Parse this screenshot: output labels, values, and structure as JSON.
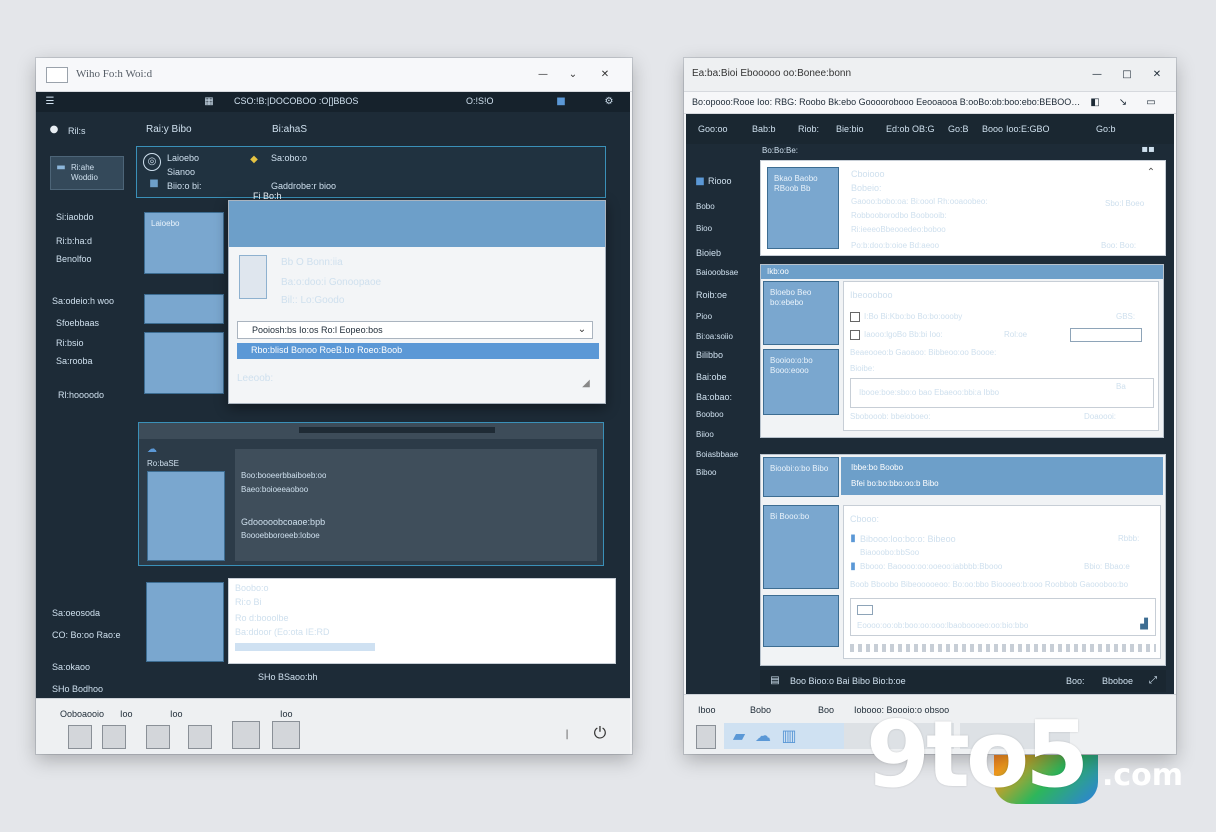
{
  "colors": {
    "background": "#e4e6ea",
    "dark_panel": "#1d2b37",
    "accent_blue": "#5b98d6",
    "card_blue": "#6d9fc9",
    "border_teal": "#3a90b8"
  },
  "left_window": {
    "title": "Wiho Fo:h Woi:d",
    "menu": [
      "CSO:!B:|DOCOBOO :O[]BBOS",
      "O:!S!O"
    ],
    "top_tabs": [
      "Rai:y Bibo",
      "Bi:ahaS"
    ],
    "sidebar": [
      "Ril:s",
      "Ri:ahe Woddio",
      "Si:iaobdo",
      "Ri:b:ha:d",
      "Benolfoo",
      "Sa:odeio:h woo",
      "Sfoebbaas",
      "Ri:bsio",
      "Sa:rooba",
      "Rl:hoooodo",
      "Sa:oeosoda",
      "CO: Bo:oo Rao:e",
      "Sa:okaoo",
      "SHo Bodhoo"
    ],
    "header_cards": [
      "Laioebo",
      "Sianoo",
      "Biio:o bi:",
      "Sa:obo:o",
      "Gaddrobe:r bioo"
    ],
    "dialog": {
      "title": "Fi Bo:h",
      "lines": [
        "Bb O Bonn:iia",
        "Ba:o:doo:i Gonoopaoe",
        "Bil:: Lo:Goodo"
      ],
      "input_value": "Pooiosh:bs Io:os Ro:l Eopeo:bos",
      "selected_row": "Rbo:blisd Bonoo RoeB.bo Roeo:Boob",
      "footer": "Leeoob:"
    },
    "lower_panel": {
      "label": "Ro:baSE",
      "lines": [
        "Boo:booeerbbaiboeb:oo",
        "Baeo:boioeeaoboo",
        "Gdooooobcoaoe:bpb",
        "Boooebboroeeb:loboe"
      ]
    },
    "bottom_card": {
      "title": "Boobo:o",
      "lines": [
        "Ri:o Bi",
        "Ro d:booolbe",
        "Ba:ddoor (Eo:ota IE:RD"
      ],
      "footer": "SHo BSaoo:bh"
    },
    "taskbar": [
      "Ooboaooio",
      "Ioo",
      "Ioo",
      "Ioo"
    ]
  },
  "right_window": {
    "title": "Ea:ba:Bioi Ebooooo oo:Bonee:bonn",
    "address": "Bo:opooo:Rooe Ioo: RBG: Roobo Bk:ebo Goooorobooo Eeooaooa B:ooBo:ob:boo:ebo:BEBOOBOOBO Oioo",
    "nav": [
      "Goo:oo",
      "Bab:b",
      "Riob:",
      "Bie:bio",
      "Ed:ob",
      "OB:G",
      "Go:B",
      "Booo",
      "Ioo:E:GBO",
      "Go:b"
    ],
    "sidebar": [
      "Riooo",
      "Bobo",
      "Bioo",
      "Bioieb",
      "Baiooobsae",
      "Roib:oe",
      "Pioo",
      "Bi:oa:soiio",
      "Bilibbo",
      "Bai:obe",
      "Ba:obao:",
      "Booboo",
      "Biioo",
      "Boiasbbaae",
      "Biboo"
    ],
    "card1": {
      "header": "Bo:Bo:Be:",
      "thumb": "Bkao Baobo RBoob Bb",
      "title": "Cboiooo",
      "subtitle": "Bobeio:",
      "lines": [
        "Gaooo:bobo:oa: Bi:oool Rh:ooaoobeo:",
        "Robbooborodbo Boobooib:",
        "Ri:ieeeoBbeooedeo:boboo"
      ],
      "right_label": "Sbo:l Boeo",
      "footer_left": "Po:b:doo:b:oioe Bd:aeoo",
      "footer_right": "Boo: Boo:"
    },
    "card2": {
      "header": "Ikb:oo",
      "thumb_top": "Bloebo Beo bo:ebebo",
      "thumb_bottom": "Booioo:o:bo Booo:eooo",
      "title": "Ibeoooboo",
      "lines": [
        "I:Bo Bi:Kbo:bo Bo:bo:oooby",
        "Iaooo:lgoBo Bb:bi Ioo:",
        "Beaeooeo:b Gaoaoo: Bibbeoo:oo Boooe:"
      ],
      "field_label": "Bioibe:",
      "info_row": "Ibooe:boe:sbo:o bao Ebaeoo:bbi:a Ibbo",
      "footer_left": "Sbobooob: bbeioboeo:",
      "footer_right": "Doaoooi:",
      "right_labels": [
        "GBS:",
        "Rol:oe",
        "Ba"
      ]
    },
    "card3": {
      "thumb_top": "Bioobi:o:bo Bibo",
      "thumb_mid": "Bi Booo:bo",
      "header_title": "Ibbe:bo Boobo",
      "header_sub": "Bfei bo:bo:bbo:oo:b Bibo",
      "title": "Cbooo:",
      "lines": [
        "Bibooo:loo:bo:o: Bibeoo",
        "Biaooobo:bbSoo",
        "Bbooo: Baoooo:oo:ooeoo:iabbbb:Bbooo",
        "Boob Bboobo Bibeooooeoo: Bo:oo:bbo Bioooeo:b:ooo Roobbob Gaoooboo:bo"
      ],
      "right_labels": [
        "Rbbb:",
        "Bbio: Bbao:e"
      ],
      "footer": "Eoooo:oo:ob:boo:oo:ooo:lbaoboooeo:oo:bio:bbo"
    },
    "status_bar": {
      "left": "Boo Bioo:o Bai Bibo Bio:b:oe",
      "right": [
        "Boo:",
        "Bboboe"
      ]
    },
    "taskbar": [
      "Iboo",
      "Bobo",
      "Boo",
      "Iobooo: Boooio:o obsoo"
    ]
  },
  "watermark": {
    "brand": "9to5",
    "suffix": ".com"
  }
}
